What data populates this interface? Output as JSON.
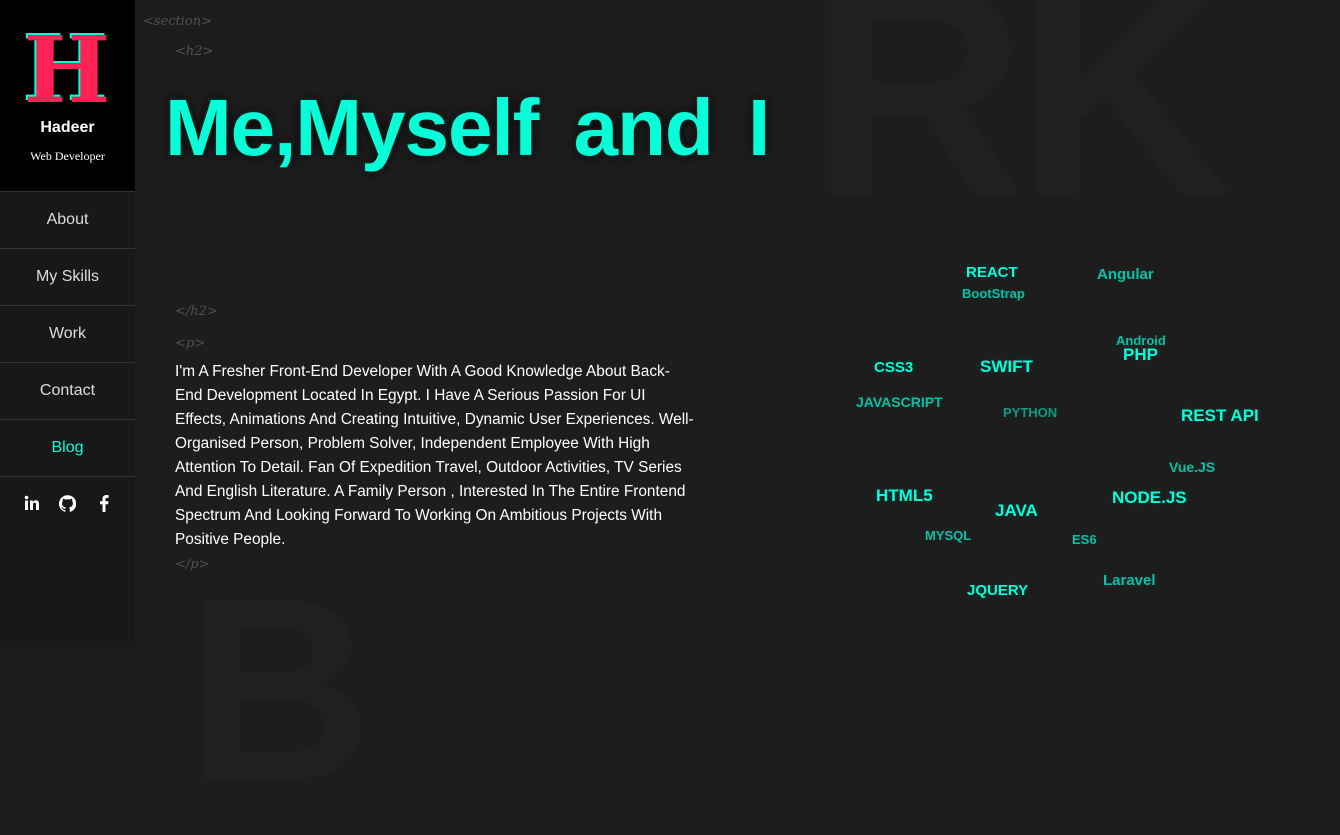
{
  "brand": {
    "logo_letter": "H",
    "name": "Hadeer",
    "subtitle": "Web Developer"
  },
  "nav": [
    {
      "label": "About"
    },
    {
      "label": "My Skills"
    },
    {
      "label": "Work"
    },
    {
      "label": "Contact"
    },
    {
      "label": "Blog",
      "active": true
    }
  ],
  "social": [
    "linkedin-icon",
    "github-icon",
    "facebook-icon"
  ],
  "background_letters": [
    "RK",
    "B"
  ],
  "tags": {
    "section_open": "<section>",
    "h2_open": "<h2>",
    "h2_close": "</h2>",
    "p_open": "<p>",
    "p_close": "</p>"
  },
  "heading": "Me,Myself  and I",
  "about_text": "I'm A Fresher Front-End Developer With A Good Knowledge About Back-End Development Located In Egypt. I Have A Serious Passion For UI Effects, Animations And Creating Intuitive, Dynamic User Experiences. Well-Organised Person, Problem Solver, Independent Employee With High Attention To Detail. Fan Of Expedition Travel, Outdoor Activities, TV Series And English Literature. A Family Person , Interested In The Entire Frontend Spectrum And Looking Forward To Working On Ambitious Projects With Positive People.",
  "skills": {
    "react": "REACT",
    "bootstrap": "BootStrap",
    "angular": "Angular",
    "android": "Android",
    "php": "PHP",
    "css3": "CSS3",
    "swift": "SWIFT",
    "javascript": "JAVASCRIPT",
    "python": "PYTHON",
    "rest_api": "REST API",
    "vuejs": "Vue.JS",
    "html5": "HTML5",
    "java": "JAVA",
    "nodejs": "NODE.JS",
    "mysql": "MYSQL",
    "es6": "ES6",
    "laravel": "Laravel",
    "jquery": "JQUERY"
  },
  "colors": {
    "accent": "#08fdd8",
    "logo_pink": "#fd2155",
    "background": "#1d1d1d",
    "sidebar": "#181818"
  }
}
